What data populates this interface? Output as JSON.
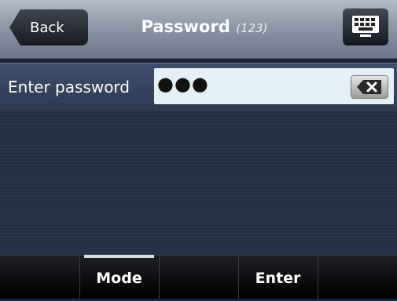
{
  "header": {
    "back_label": "Back",
    "title": "Password",
    "title_mode": "(123)",
    "keyboard_icon": "keyboard-icon"
  },
  "input": {
    "label": "Enter password",
    "value": "●●●",
    "clear_icon": "backspace-icon"
  },
  "softkeys": [
    {
      "label": ""
    },
    {
      "label": "Mode"
    },
    {
      "label": ""
    },
    {
      "label": "Enter"
    },
    {
      "label": ""
    }
  ],
  "colors": {
    "header_gradient_top": "#b5bcc8",
    "input_bg": "#e3f1f7",
    "body_bg": "#27344c",
    "softkey_bg": "#000000"
  }
}
